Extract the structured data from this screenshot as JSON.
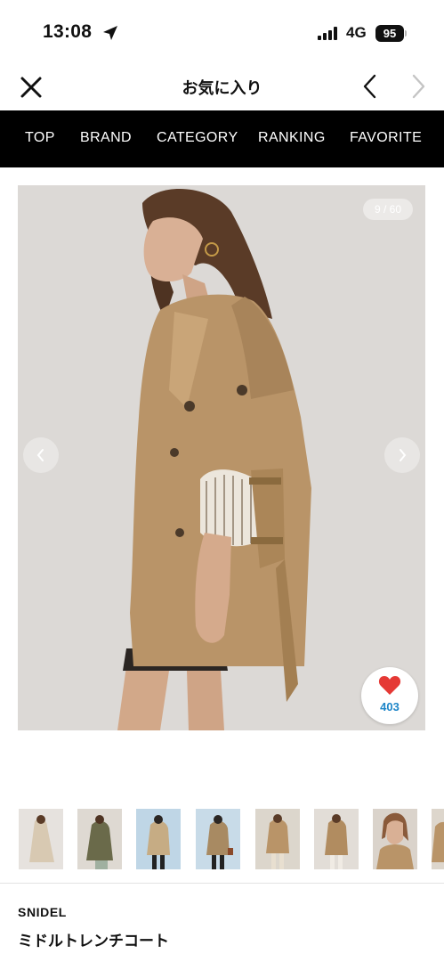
{
  "status_bar": {
    "time": "13:08",
    "network": "4G",
    "battery": "95",
    "icons": [
      "location-arrow-icon",
      "signal-bars-icon",
      "battery-icon"
    ]
  },
  "header": {
    "title": "お気に入り",
    "icons": [
      "close-icon",
      "chevron-left-icon",
      "chevron-right-icon"
    ]
  },
  "nav": {
    "items": [
      {
        "label": "TOP"
      },
      {
        "label": "BRAND"
      },
      {
        "label": "CATEGORY"
      },
      {
        "label": "RANKING"
      },
      {
        "label": "FAVORITE"
      }
    ]
  },
  "gallery": {
    "counter": "9 / 60",
    "favorite_count": "403",
    "colors": {
      "heart": "#e53935",
      "count": "#1e86c8",
      "nav_bg": "#000000"
    }
  },
  "product": {
    "brand": "SNIDEL",
    "name": "ミドルトレンチコート"
  }
}
